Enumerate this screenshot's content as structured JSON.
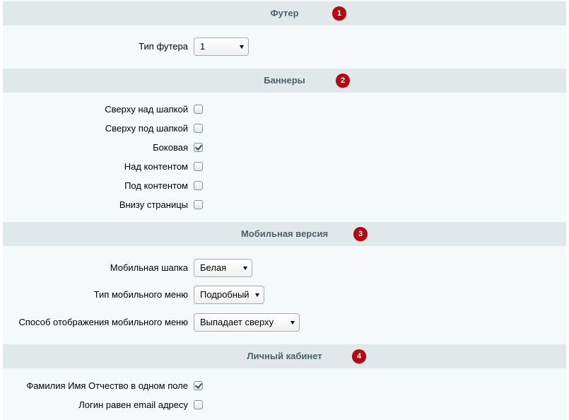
{
  "sections": [
    {
      "title": "Футер",
      "badge": "1",
      "selects": [
        {
          "label": "Тип футера",
          "value": "1"
        }
      ]
    },
    {
      "title": "Баннеры",
      "badge": "2",
      "checkboxes": [
        {
          "label": "Сверху над шапкой",
          "checked": false
        },
        {
          "label": "Сверху под шапкой",
          "checked": false
        },
        {
          "label": "Боковая",
          "checked": true
        },
        {
          "label": "Над контентом",
          "checked": false
        },
        {
          "label": "Под контентом",
          "checked": false
        },
        {
          "label": "Внизу страницы",
          "checked": false
        }
      ]
    },
    {
      "title": "Мобильная версия",
      "badge": "3",
      "selects": [
        {
          "label": "Мобильная шапка",
          "value": "Белая"
        },
        {
          "label": "Тип мобильного меню",
          "value": "Подробный"
        },
        {
          "label": "Способ отображения мобильного меню",
          "value": "Выпадает сверху"
        }
      ]
    },
    {
      "title": "Личный кабинет",
      "badge": "4",
      "checkboxes": [
        {
          "label": "Фамилия Имя Отчество в одном поле",
          "checked": true
        },
        {
          "label": "Логин равен email адресу",
          "checked": false
        }
      ]
    }
  ],
  "colors": {
    "header_bg": "#e0e8ea",
    "header_text": "#4b6267",
    "body_bg": "#f5f9f9",
    "badge_bg": "#b10a10"
  },
  "icons": {
    "select_arrow": "triangle-down-icon",
    "check": "checkmark-icon"
  }
}
